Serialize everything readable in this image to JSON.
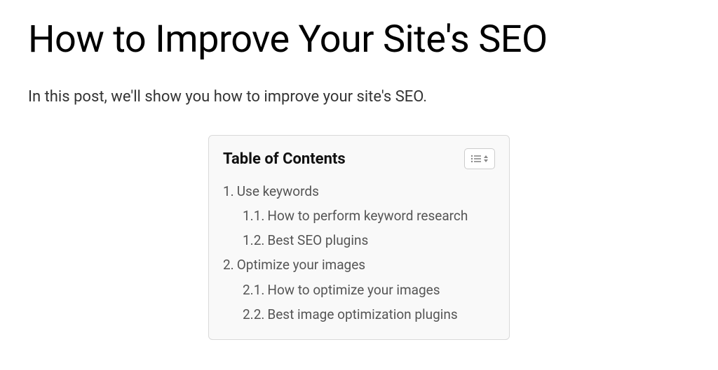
{
  "title": "How to Improve Your Site's SEO",
  "intro": "In this post, we'll show you how to improve your site's SEO.",
  "toc": {
    "heading": "Table of Contents",
    "items": [
      {
        "num": "1.",
        "label": "Use keywords",
        "level": 1
      },
      {
        "num": "1.1.",
        "label": "How to perform keyword research",
        "level": 2
      },
      {
        "num": "1.2.",
        "label": "Best SEO plugins",
        "level": 2
      },
      {
        "num": "2.",
        "label": "Optimize your images",
        "level": 1
      },
      {
        "num": "2.1.",
        "label": "How to optimize your images",
        "level": 2
      },
      {
        "num": "2.2.",
        "label": "Best image optimization plugins",
        "level": 2
      }
    ]
  }
}
